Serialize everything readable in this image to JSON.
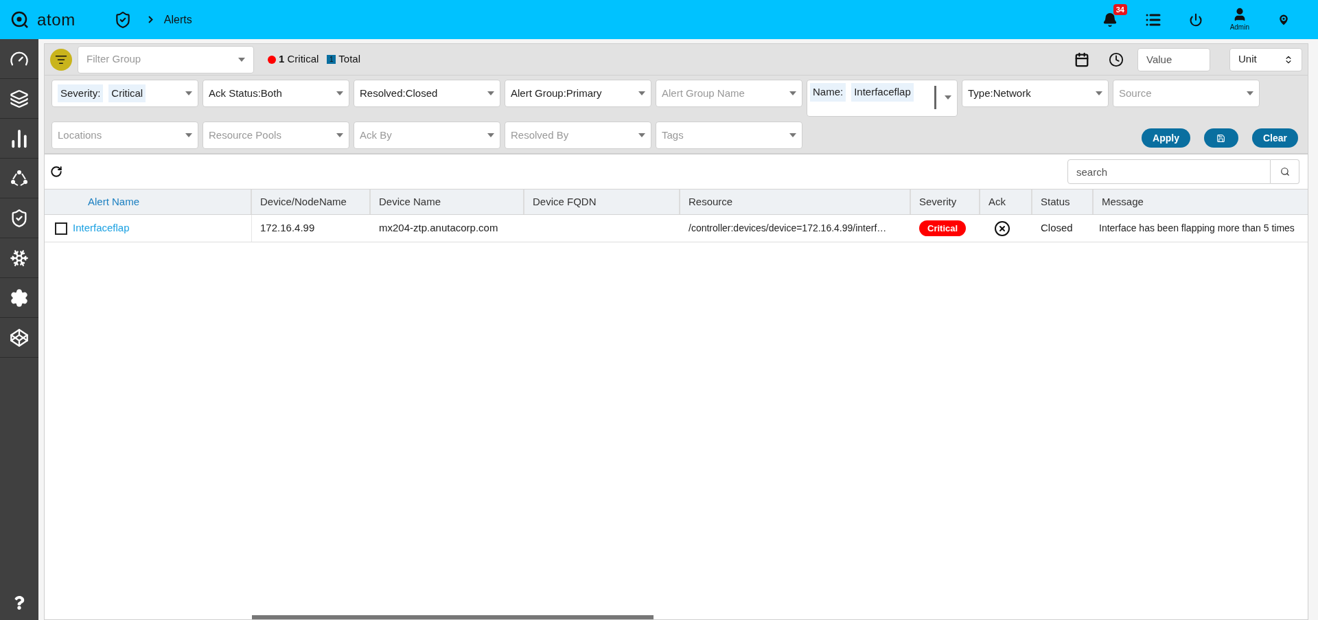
{
  "header": {
    "logo": "atom",
    "breadcrumb": "Alerts",
    "notification_count": "34",
    "user": "Admin"
  },
  "toolbar": {
    "filter_group": {
      "placeholder": "Filter Group"
    },
    "critical_count": "1",
    "critical_label": "Critical",
    "total_count": "1",
    "total_label": "Total",
    "value": {
      "placeholder": "Value"
    },
    "unit": "Unit"
  },
  "filter_rows": [
    [
      {
        "kind": "chip",
        "label": "Severity:",
        "value": "Critical"
      },
      {
        "kind": "value",
        "value": "Ack Status:Both"
      },
      {
        "kind": "value",
        "value": "Resolved:Closed"
      },
      {
        "kind": "value",
        "value": "Alert Group:Primary"
      },
      {
        "kind": "empty",
        "placeholder": "Alert Group Name"
      },
      {
        "kind": "multi",
        "label": "Name:",
        "value": "Interfaceflap"
      },
      {
        "kind": "value",
        "value": "Type:Network"
      },
      {
        "kind": "empty",
        "placeholder": "Source"
      }
    ],
    [
      {
        "kind": "empty",
        "placeholder": "Locations"
      },
      {
        "kind": "empty",
        "placeholder": "Resource Pools"
      },
      {
        "kind": "empty",
        "placeholder": "Ack By"
      },
      {
        "kind": "empty",
        "placeholder": "Resolved By"
      },
      {
        "kind": "empty",
        "placeholder": "Tags"
      }
    ]
  ],
  "actions": [
    {
      "kind": "text",
      "label": "Apply"
    },
    {
      "kind": "save"
    },
    {
      "kind": "text",
      "label": "Clear"
    }
  ],
  "table": {
    "search": {
      "placeholder": "search"
    },
    "columns": [
      "Alert Name",
      "Device/NodeName",
      "Device Name",
      "Device FQDN",
      "Resource",
      "Severity",
      "Ack",
      "Status",
      "Message"
    ],
    "rows": [
      {
        "checked": false,
        "alert_name": "Interfaceflap",
        "device_node": "172.16.4.99",
        "device_name": "mx204-ztp.anutacorp.com",
        "device_fqdn": "",
        "resource": "/controller:devices/device=172.16.4.99/interf…",
        "severity": "Critical",
        "acknowledged": false,
        "status": "Closed",
        "message": "Interface has been flapping more than 5 times"
      }
    ]
  }
}
